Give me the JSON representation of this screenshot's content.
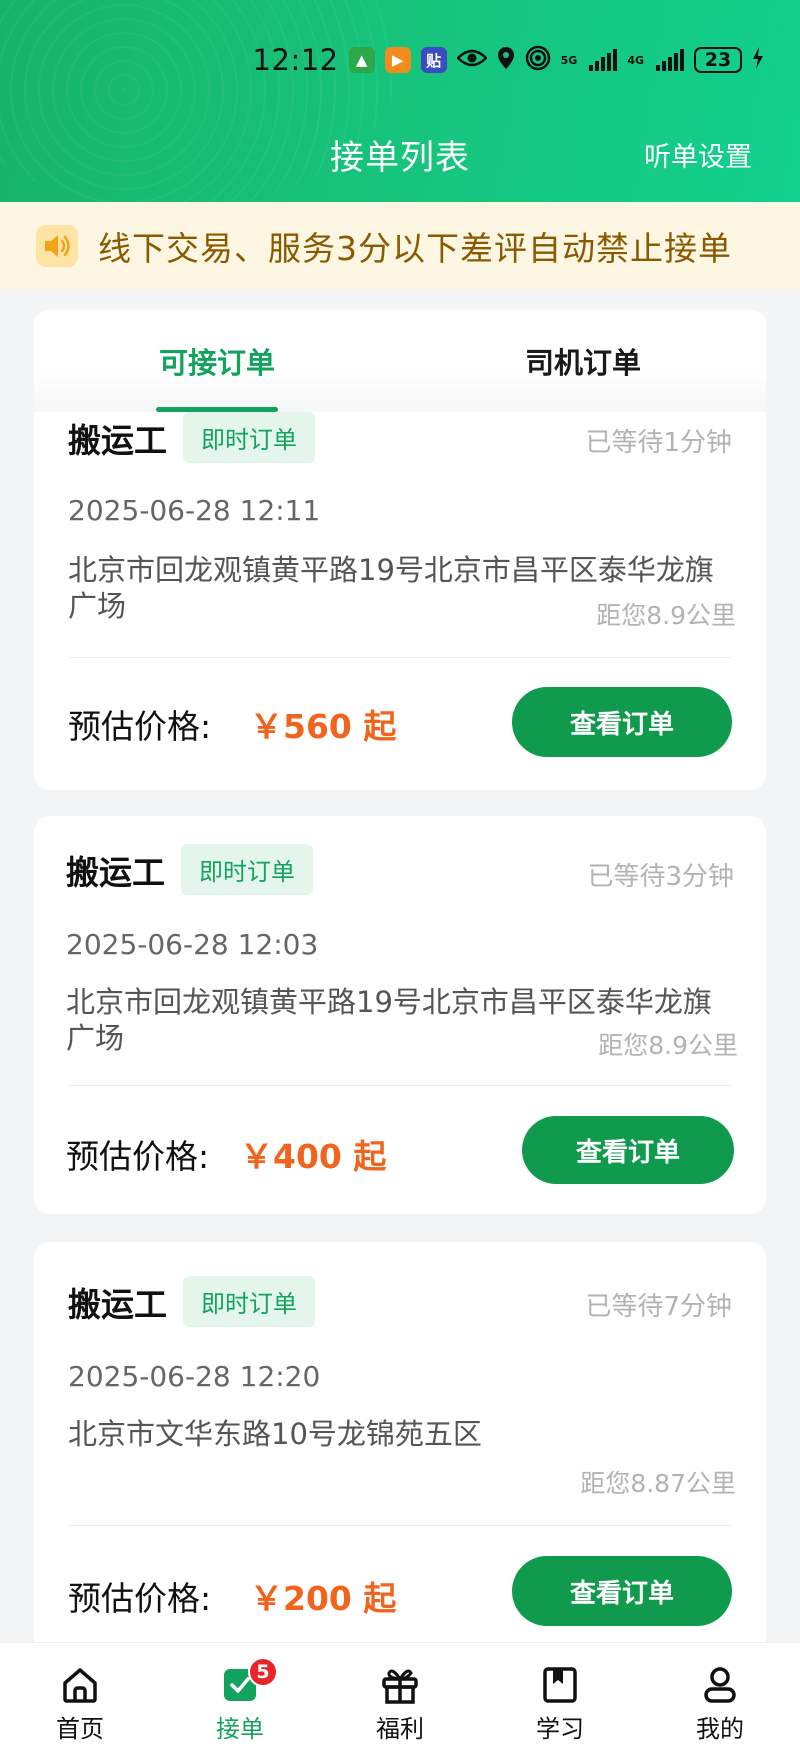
{
  "status_bar": {
    "time": "12:12",
    "battery": "23",
    "signal1": "5G",
    "signal2": "4G"
  },
  "nav": {
    "title": "接单列表",
    "right_action": "听单设置"
  },
  "notice": {
    "text": "线下交易、服务3分以下差评自动禁止接单"
  },
  "tabs": [
    {
      "label": "可接订单",
      "active": true
    },
    {
      "label": "司机订单",
      "active": false
    }
  ],
  "orders": [
    {
      "title": "搬运工",
      "badge": "即时订单",
      "wait": "已等待1分钟",
      "time": "2025-06-28 12:11",
      "address": "北京市回龙观镇黄平路19号北京市昌平区泰华龙旗广场",
      "distance": "距您8.9公里",
      "price_label": "预估价格:",
      "price": "￥560 起",
      "button": "查看订单"
    },
    {
      "title": "搬运工",
      "badge": "即时订单",
      "wait": "已等待3分钟",
      "time": "2025-06-28 12:03",
      "address": "北京市回龙观镇黄平路19号北京市昌平区泰华龙旗广场",
      "distance": "距您8.9公里",
      "price_label": "预估价格:",
      "price": "￥400 起",
      "button": "查看订单"
    },
    {
      "title": "搬运工",
      "badge": "即时订单",
      "wait": "已等待7分钟",
      "time": "2025-06-28 12:20",
      "address": "北京市文华东路10号龙锦苑五区",
      "distance": "距您8.87公里",
      "price_label": "预估价格:",
      "price": "￥200 起",
      "button": "查看订单"
    }
  ],
  "bottom_nav": [
    {
      "label": "首页",
      "icon": "home-icon"
    },
    {
      "label": "接单",
      "icon": "order-check-icon",
      "badge": "5",
      "active": true
    },
    {
      "label": "福利",
      "icon": "gift-icon"
    },
    {
      "label": "学习",
      "icon": "book-icon"
    },
    {
      "label": "我的",
      "icon": "profile-icon"
    }
  ],
  "colors": {
    "brand_green": "#13a35e",
    "button_green": "#109a4d",
    "price_orange": "#f0641e",
    "notice_bg": "#fdf6e3",
    "notice_text": "#8a5a00",
    "badge_red": "#e8252c"
  }
}
